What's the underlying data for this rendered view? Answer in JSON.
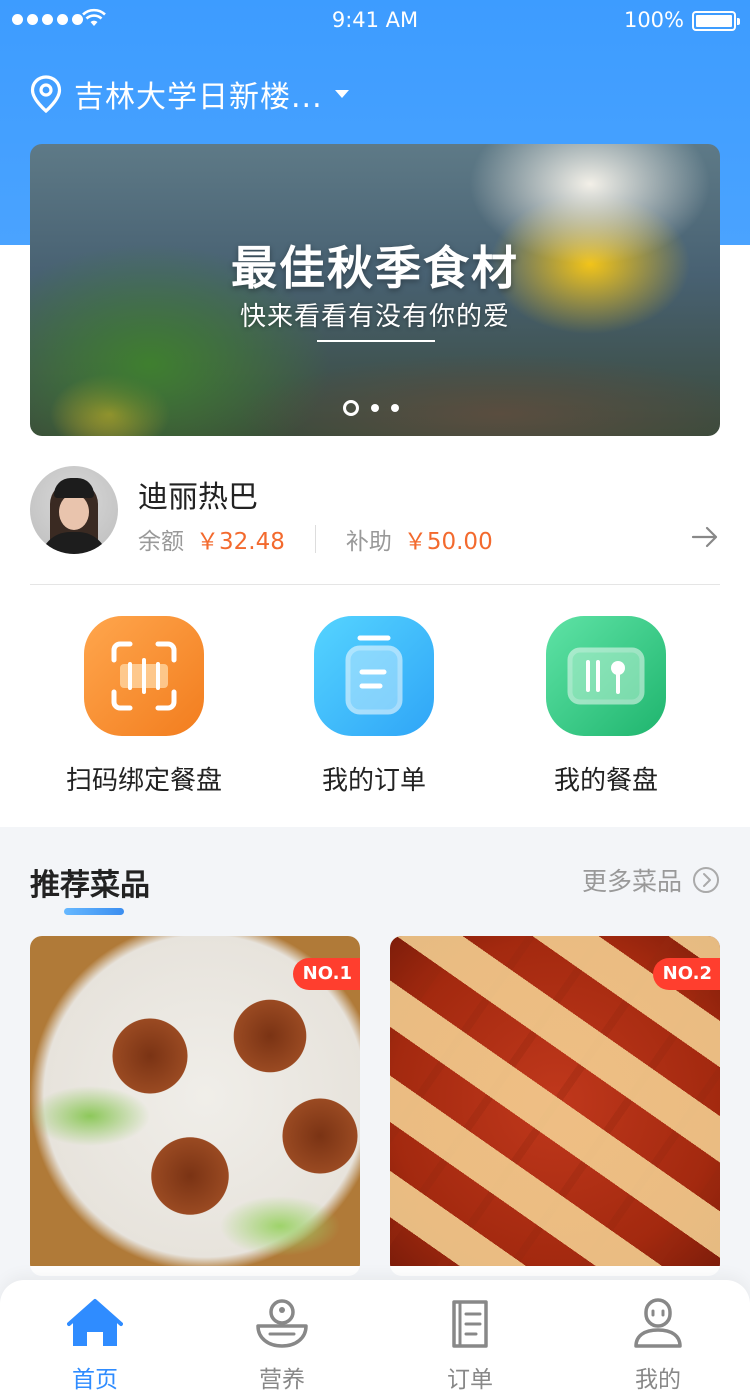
{
  "status_bar": {
    "time": "9:41 AM",
    "battery_percent": "100%"
  },
  "location": {
    "text": "吉林大学日新楼..."
  },
  "banner": {
    "title": "最佳秋季食材",
    "subtitle": "快来看看有没有你的爱",
    "active_slide": 1,
    "slide_count": 3
  },
  "profile": {
    "name": "迪丽热巴",
    "balance_label": "余额",
    "balance_value": "￥32.48",
    "subsidy_label": "补助",
    "subsidy_value": "￥50.00"
  },
  "features": [
    {
      "label": "扫码绑定餐盘",
      "icon": "scan-icon"
    },
    {
      "label": "我的订单",
      "icon": "order-icon"
    },
    {
      "label": "我的餐盘",
      "icon": "tray-icon"
    }
  ],
  "recommend": {
    "title": "推荐菜品",
    "more_label": "更多菜品",
    "dishes": [
      {
        "rank": "NO.1",
        "image": "braised-meatballs"
      },
      {
        "rank": "NO.2",
        "image": "mapo-tofu"
      }
    ]
  },
  "tabbar": {
    "active": "home",
    "items": [
      {
        "label": "首页",
        "icon": "home-icon"
      },
      {
        "label": "营养",
        "icon": "bowl-icon"
      },
      {
        "label": "订单",
        "icon": "document-icon"
      },
      {
        "label": "我的",
        "icon": "person-icon"
      }
    ]
  },
  "colors": {
    "primary": "#3d9cff",
    "price": "#f36a2e",
    "badge": "#ff3e2e",
    "orange": "#f27d1e",
    "blue": "#2fa5f7",
    "green": "#1fb56e"
  }
}
